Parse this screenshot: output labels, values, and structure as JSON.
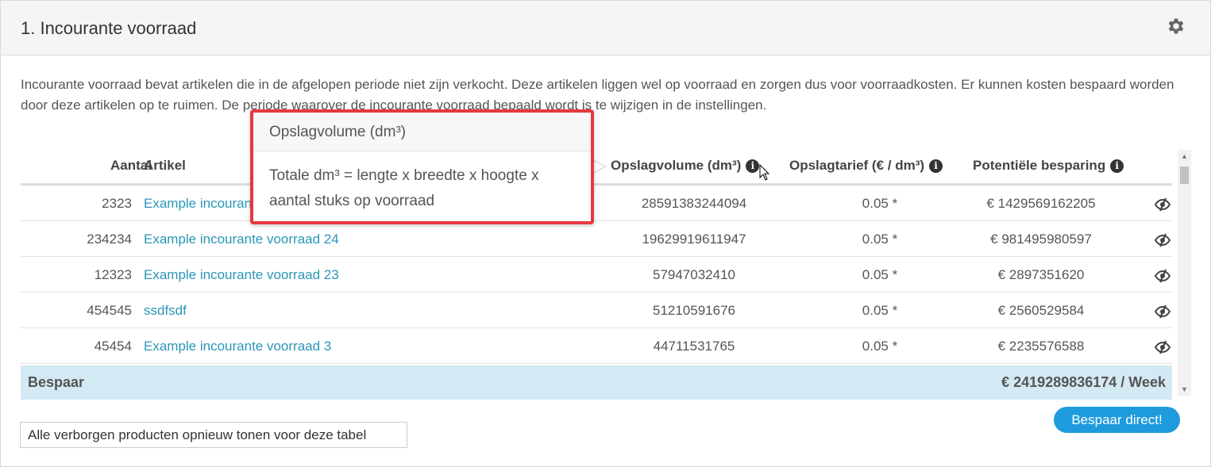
{
  "header": {
    "title": "1. Incourante voorraad",
    "settings_icon": "gear-icon"
  },
  "description": "Incourante voorraad bevat artikelen die in de afgelopen periode niet zijn verkocht. Deze artikelen liggen wel op voorraad en zorgen dus voor voorraadkosten. Er kunnen kosten bespaard worden door deze artikelen op te ruimen. De periode waarover de incourante voorraad bepaald wordt is te wijzigen in de instellingen.",
  "table": {
    "columns": {
      "aantal": "Aantal",
      "artikel": "Artikel",
      "opslagvolume": "Opslagvolume (dm³)",
      "opslagtarief": "Opslagtarief (€ / dm³)",
      "besparing": "Potentiële besparing"
    },
    "rows": [
      {
        "aantal": "2323",
        "artikel": "Example incourante voorraad 25",
        "volume": "28591383244094",
        "tarief": "0.05 *",
        "besparing": "€ 1429569162205"
      },
      {
        "aantal": "234234",
        "artikel": "Example incourante voorraad 24",
        "volume": "19629919611947",
        "tarief": "0.05 *",
        "besparing": "€ 981495980597"
      },
      {
        "aantal": "12323",
        "artikel": "Example incourante voorraad 23",
        "volume": "57947032410",
        "tarief": "0.05 *",
        "besparing": "€ 2897351620"
      },
      {
        "aantal": "454545",
        "artikel": "ssdfsdf",
        "volume": "51210591676",
        "tarief": "0.05 *",
        "besparing": "€ 2560529584"
      },
      {
        "aantal": "45454",
        "artikel": "Example incourante voorraad 3",
        "volume": "44711531765",
        "tarief": "0.05 *",
        "besparing": "€ 2235576588"
      }
    ],
    "total": {
      "label": "Bespaar",
      "value": "€ 2419289836174 / Week"
    }
  },
  "buttons": {
    "direct": "Bespaar direct!",
    "show_hidden": "Alle verborgen producten opnieuw tonen voor deze tabel"
  },
  "popover": {
    "title": "Opslagvolume (dm³)",
    "body": "Totale dm³ = lengte x breedte x hoogte x aantal stuks op voorraad"
  },
  "colors": {
    "link": "#2a96b8",
    "total_bg": "#d3e9f3",
    "primary_button": "#1e9bdc",
    "highlight_border": "#e8373f"
  }
}
